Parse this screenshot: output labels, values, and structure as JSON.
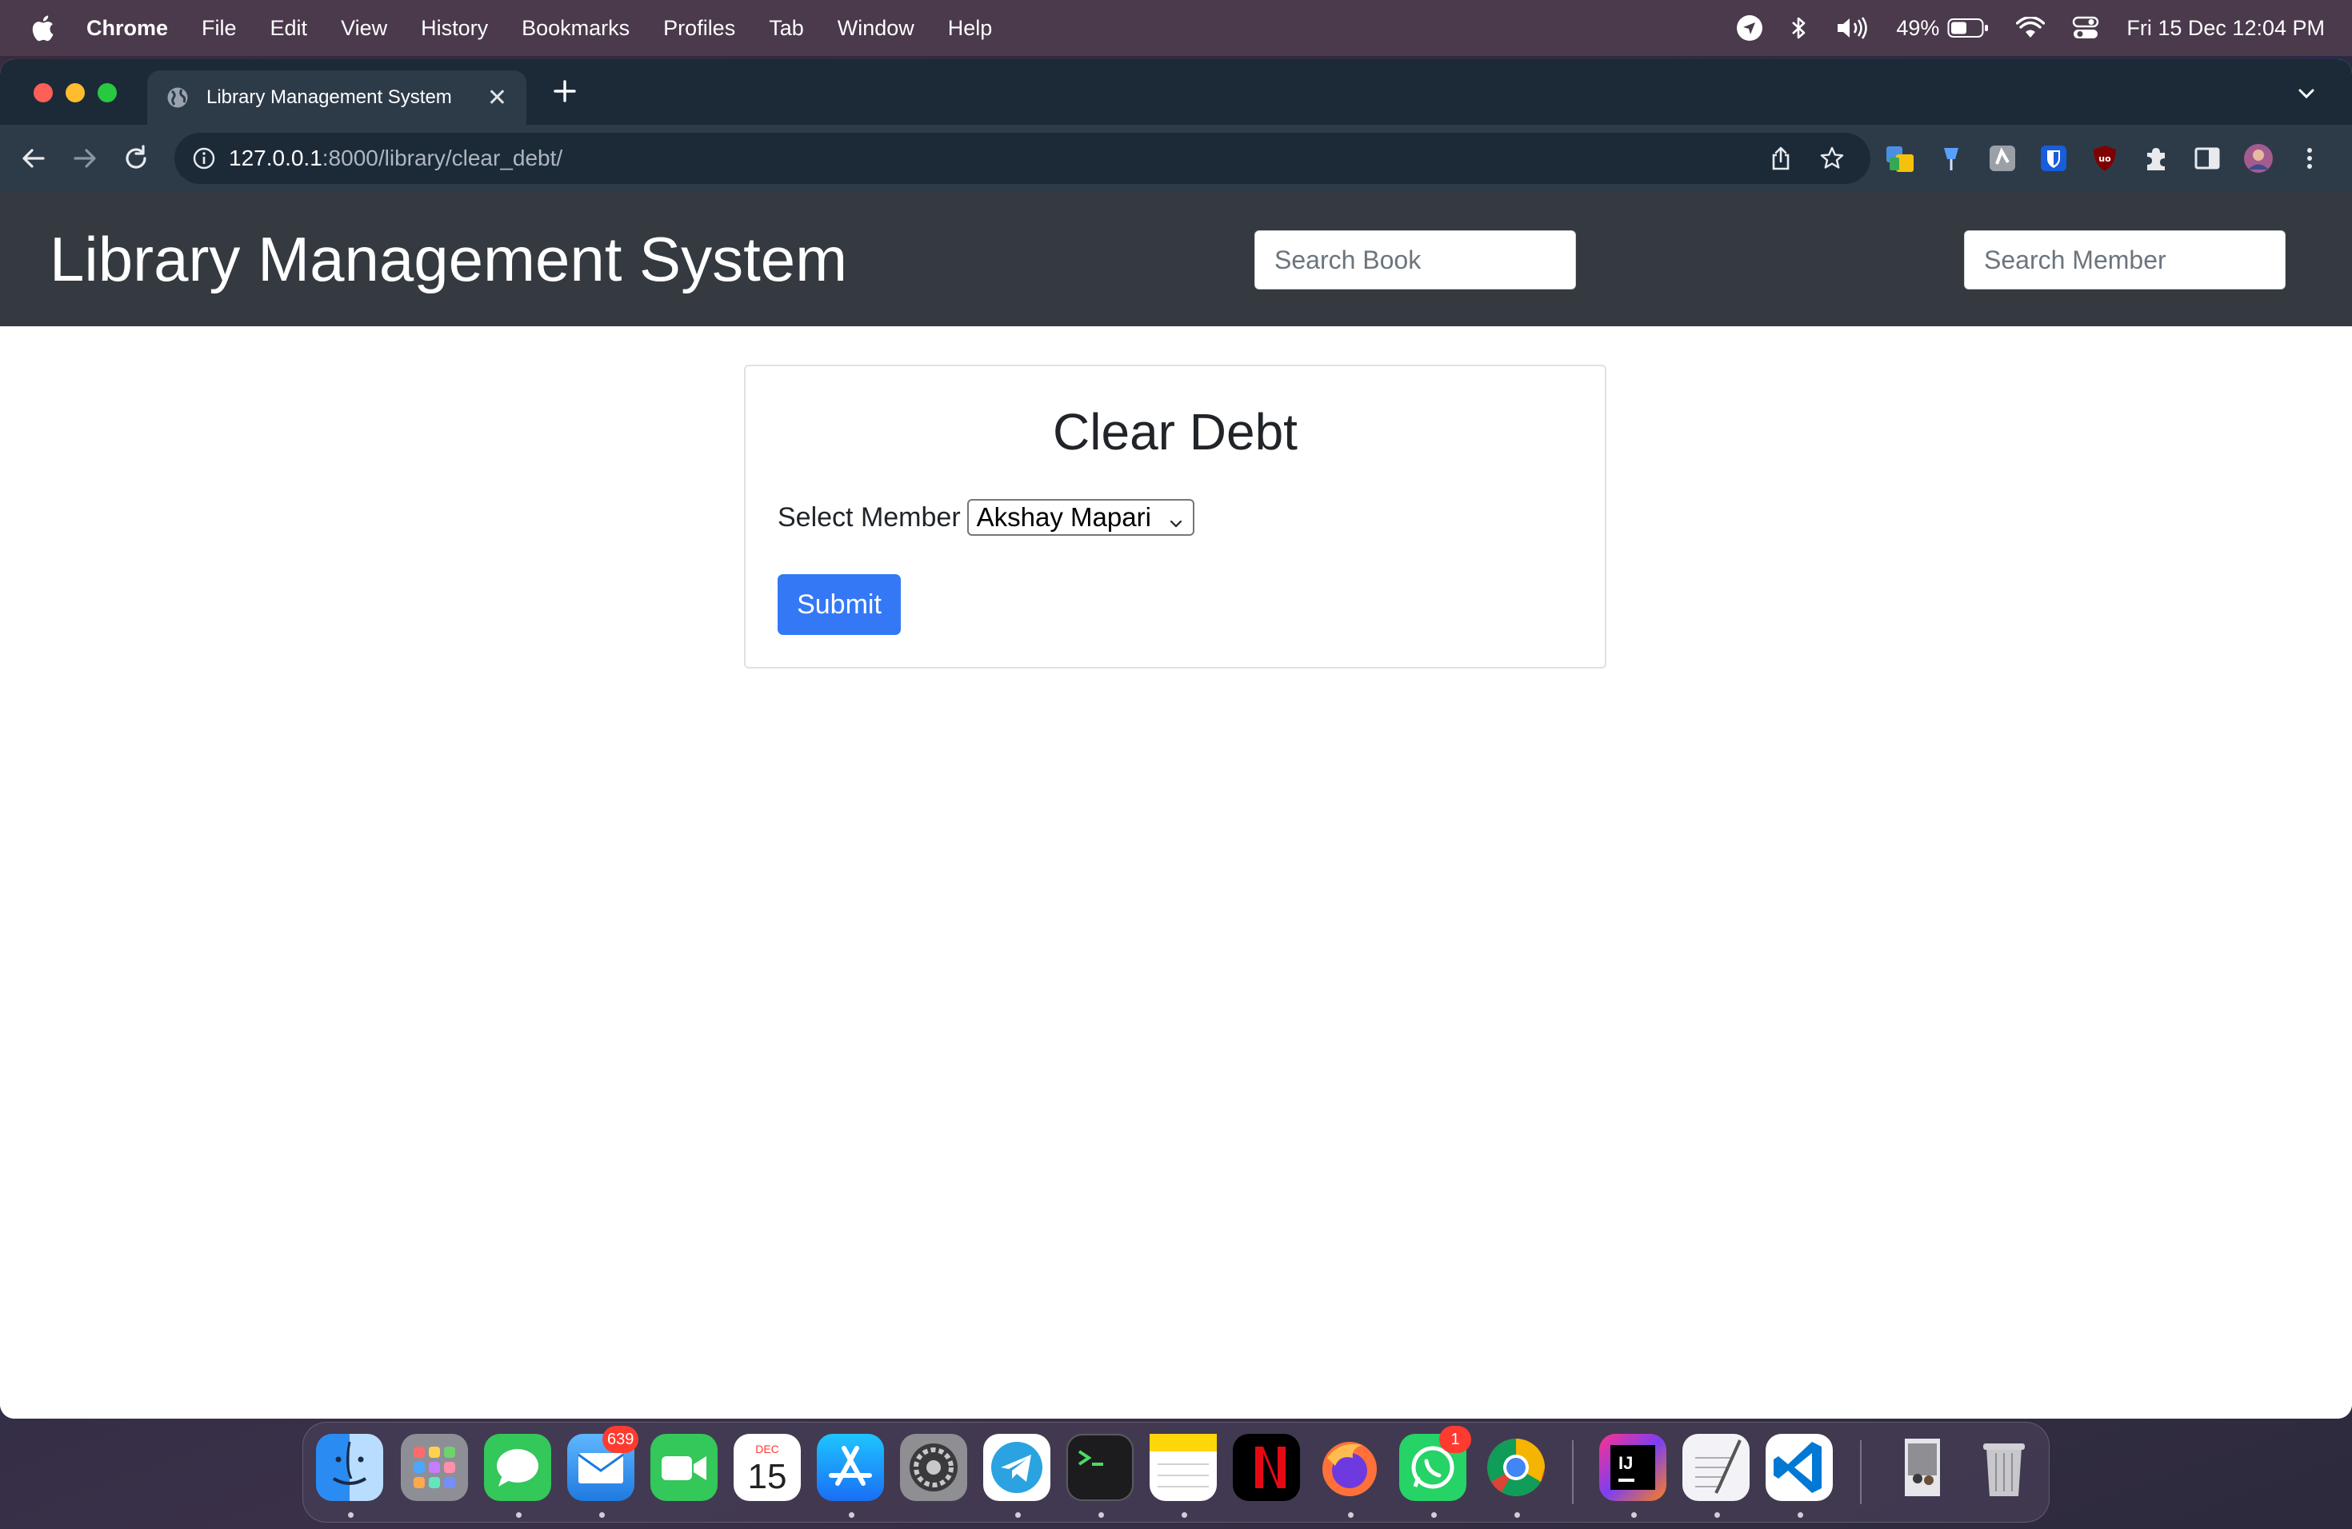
{
  "menubar": {
    "app_name": "Chrome",
    "items": [
      "File",
      "Edit",
      "View",
      "History",
      "Bookmarks",
      "Profiles",
      "Tab",
      "Window",
      "Help"
    ],
    "battery": "49%",
    "clock": "Fri 15 Dec  12:04 PM"
  },
  "browser": {
    "tab_title": "Library Management System",
    "url_host": "127.0.0.1",
    "url_path": ":8000/library/clear_debt/"
  },
  "page": {
    "brand": "Library Management System",
    "search_book_placeholder": "Search Book",
    "search_member_placeholder": "Search Member",
    "card": {
      "title": "Clear Debt",
      "member_label": "Select Member",
      "member_selected": "Akshay Mapari",
      "submit_label": "Submit"
    }
  },
  "dock": {
    "mail_badge": "639",
    "calendar_month": "DEC",
    "calendar_day": "15",
    "whatsapp_badge": "1",
    "intellij_label": "IJ"
  },
  "colors": {
    "navbar": "#343a40",
    "primary_button": "#3478f6",
    "tabbar": "#1c2a38",
    "toolbar": "#2d3b49"
  }
}
